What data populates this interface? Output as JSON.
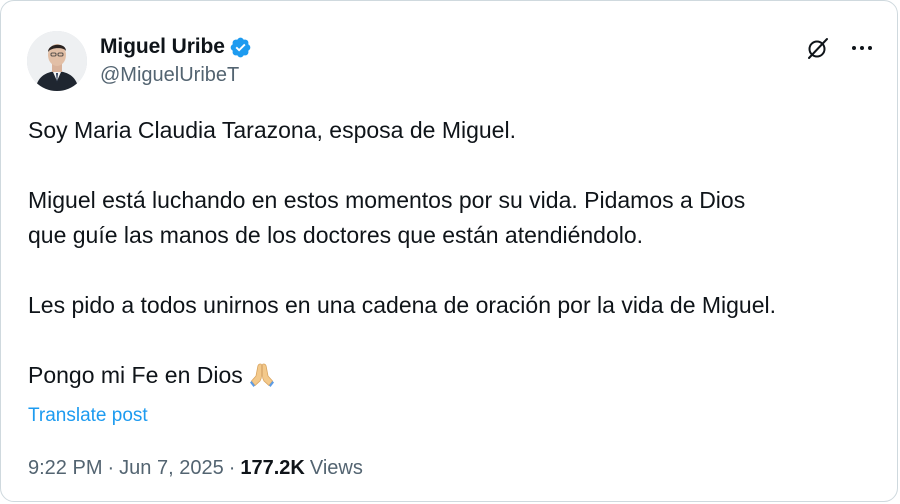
{
  "post": {
    "author": {
      "display_name": "Miguel Uribe",
      "handle": "@MiguelUribeT",
      "verified_icon": "verified-badge-icon",
      "verified_color": "#1d9bf0"
    },
    "actions": {
      "grok_icon": "grok-icon",
      "more_icon": "more-options-icon"
    },
    "paragraphs": [
      "Soy Maria Claudia Tarazona, esposa de Miguel.",
      "Miguel está luchando en estos momentos por su vida. Pidamos a Dios",
      "que guíe las manos de los doctores que están atendiéndolo.",
      "Les pido a todos unirnos en una cadena de oración por la vida de Miguel.",
      "Pongo mi Fe en Dios"
    ],
    "emoji": "folded-hands-icon",
    "translate_label": "Translate post",
    "time": "9:22 PM",
    "separator": "·",
    "date": "Jun 7, 2025",
    "views_count": "177.2K",
    "views_label": "Views",
    "accent_color": "#1d9bf0",
    "secondary_text_color": "#536471"
  }
}
